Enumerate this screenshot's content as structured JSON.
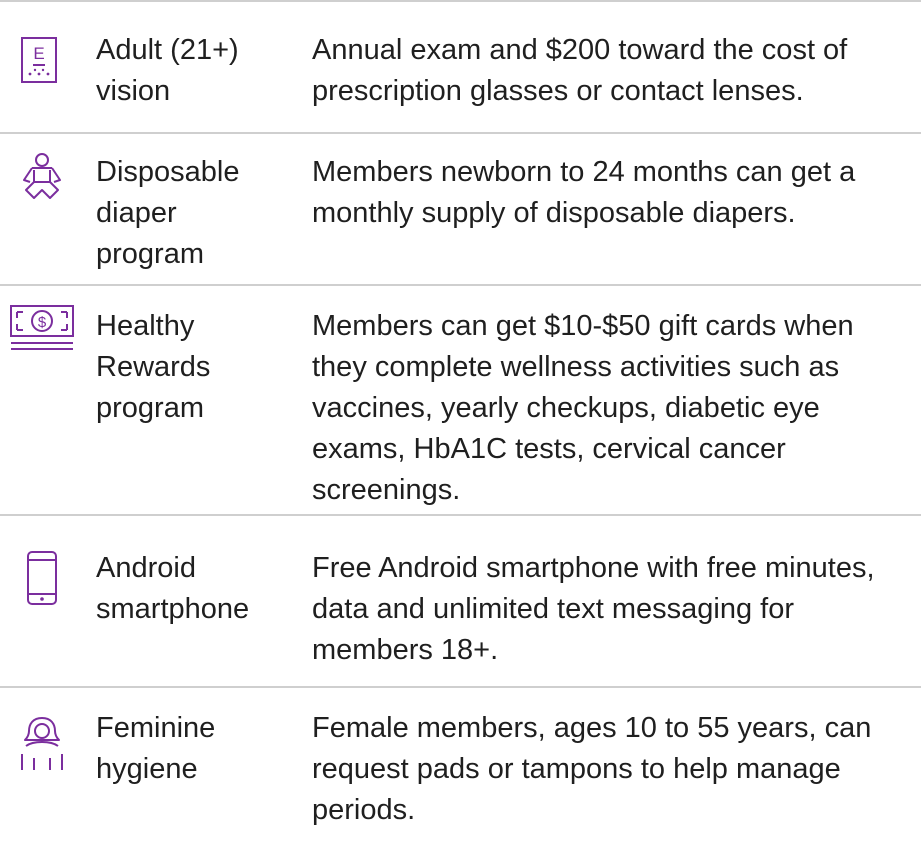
{
  "accent_color": "#7b2e9e",
  "rows": [
    {
      "icon": "eye-chart-icon",
      "name": "Adult (21+) vision",
      "description": "Annual exam and $200 toward the cost of prescription glasses or contact lenses."
    },
    {
      "icon": "baby-icon",
      "name": "Disposable diaper program",
      "description": "Members newborn to 24 months can get a monthly supply of disposable diapers."
    },
    {
      "icon": "dollar-bill-icon",
      "name": "Healthy Rewards program",
      "description": "Members can get $10-$50 gift cards when they complete wellness activities such as vaccines, yearly checkups, diabetic eye exams, HbA1C tests, cervical cancer screenings."
    },
    {
      "icon": "smartphone-icon",
      "name": "Android smartphone",
      "description": "Free Android smartphone with free minutes, data and unlimited text messaging for members 18+."
    },
    {
      "icon": "woman-icon",
      "name": "Feminine hygiene",
      "description": "Female members, ages 10 to 55 years, can request pads or tampons to help manage periods."
    }
  ]
}
